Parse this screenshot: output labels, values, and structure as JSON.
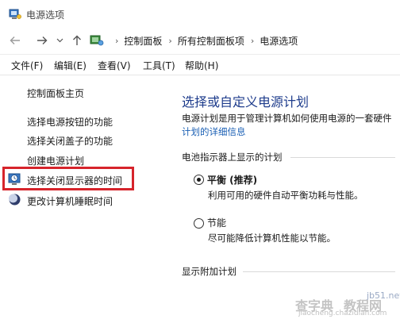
{
  "window": {
    "title": "电源选项"
  },
  "breadcrumbs": [
    "控制面板",
    "所有控制面板项",
    "电源选项"
  ],
  "menu": [
    "文件(F)",
    "编辑(E)",
    "查看(V)",
    "工具(T)",
    "帮助(H)"
  ],
  "sidebar": {
    "home": "控制面板主页",
    "items": [
      "选择电源按钮的功能",
      "选择关闭盖子的功能",
      "创建电源计划",
      "选择关闭显示器的时间",
      "更改计算机睡眠时间"
    ]
  },
  "main": {
    "title": "选择或自定义电源计划",
    "description": "电源计划是用于管理计算机如何使用电源的一套硬件",
    "details_link": "计划的详细信息",
    "battery_section": "电池指示器上显示的计划",
    "plans": [
      {
        "name": "平衡 (推荐)",
        "desc": "利用可用的硬件自动平衡功耗与性能。",
        "selected": true
      },
      {
        "name": "节能",
        "desc": "尽可能降低计算机性能以节能。",
        "selected": false
      }
    ],
    "extra_section": "显示附加计划"
  },
  "watermark": {
    "left": "查字典",
    "mid": "教程网",
    "site": "jb51.net",
    "url": "jiaocheng.chazidian.com"
  },
  "colors": {
    "title_blue": "#1e3c8c",
    "link_blue": "#1a5fb4",
    "highlight_red": "#d6242b"
  },
  "icons": [
    "power-options-icon",
    "back-arrow-icon",
    "forward-arrow-icon",
    "dropdown-chevron-icon",
    "up-arrow-icon",
    "control-panel-icon",
    "clock-display-icon",
    "moon-sleep-icon"
  ]
}
